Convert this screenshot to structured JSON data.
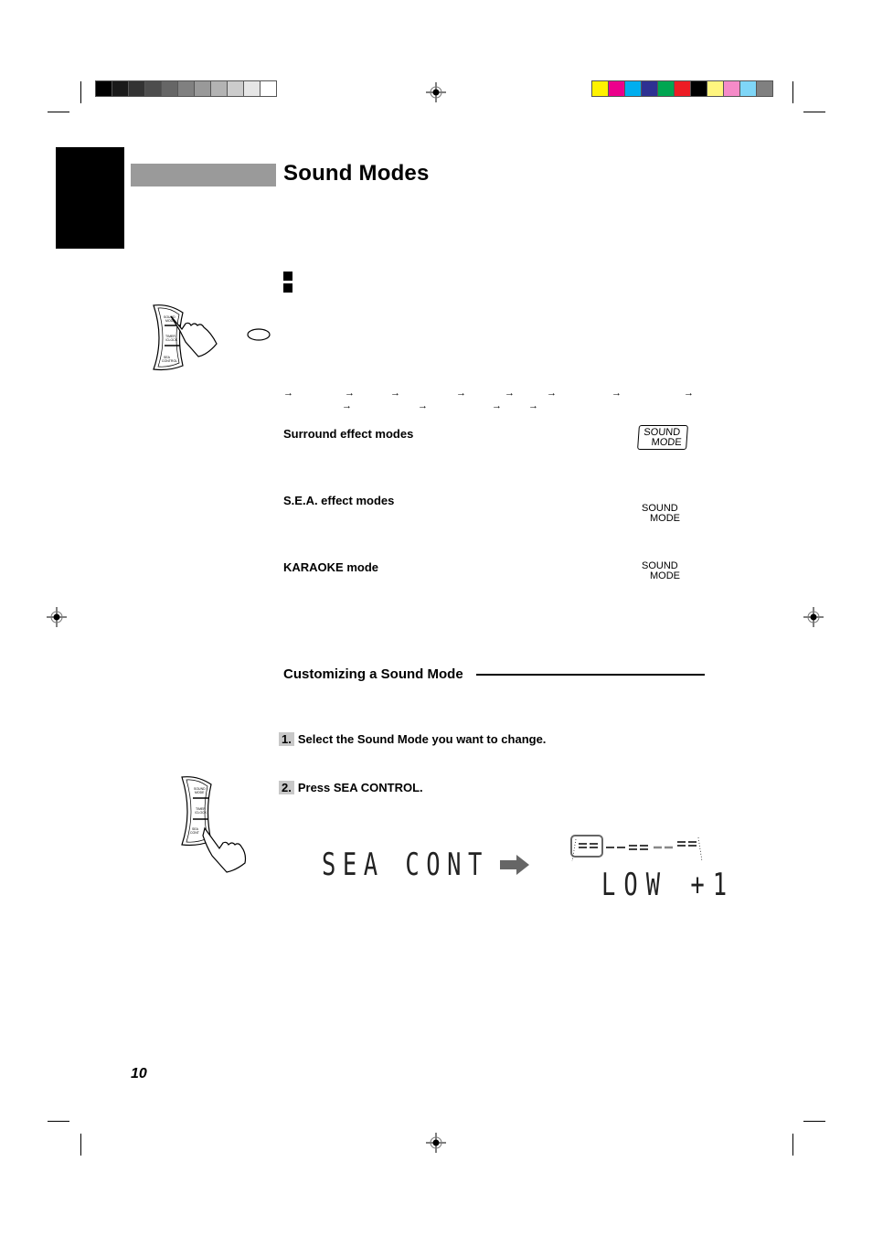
{
  "print_marks": {
    "grayscale_swatches": [
      "#000000",
      "#1a1a1a",
      "#333333",
      "#4d4d4d",
      "#666666",
      "#808080",
      "#999999",
      "#b3b3b3",
      "#cccccc",
      "#e6e6e6",
      "#ffffff"
    ],
    "color_swatches": [
      "#fff200",
      "#ec008c",
      "#00aeef",
      "#2e3192",
      "#00a651",
      "#ed1c24",
      "#000000",
      "#fff57f",
      "#f58bc8",
      "#7fd6f7",
      "#808080"
    ]
  },
  "header": {
    "title": "Sound Modes"
  },
  "remote_top": {
    "buttons": [
      "SOUND MODE",
      "TIMER /CLOCK",
      "SEA CONTROL"
    ]
  },
  "sections": [
    {
      "heading": "Surround effect modes",
      "button_label": [
        "SOUND",
        "MODE"
      ],
      "boxed": true
    },
    {
      "heading": "S.E.A. effect modes",
      "button_label": [
        "SOUND",
        "MODE"
      ],
      "boxed": false
    },
    {
      "heading": "KARAOKE mode",
      "button_label": [
        "SOUND",
        "MODE"
      ],
      "boxed": false
    }
  ],
  "sequence_arrows": {
    "row1_count": 8,
    "row2_count": 4,
    "glyph": "→"
  },
  "customizing": {
    "heading": "Customizing a Sound Mode",
    "steps": [
      {
        "num": "1.",
        "text": "Select the Sound Mode you want to change."
      },
      {
        "num": "2.",
        "text": "Press SEA CONTROL."
      }
    ],
    "display_before": "SEA CONT",
    "display_after": "LOW +1",
    "remote_buttons": [
      "SOUND MODE",
      "TIMER /CLOCK",
      "SEA CONTROL"
    ]
  },
  "footer": {
    "page_number": "10"
  }
}
